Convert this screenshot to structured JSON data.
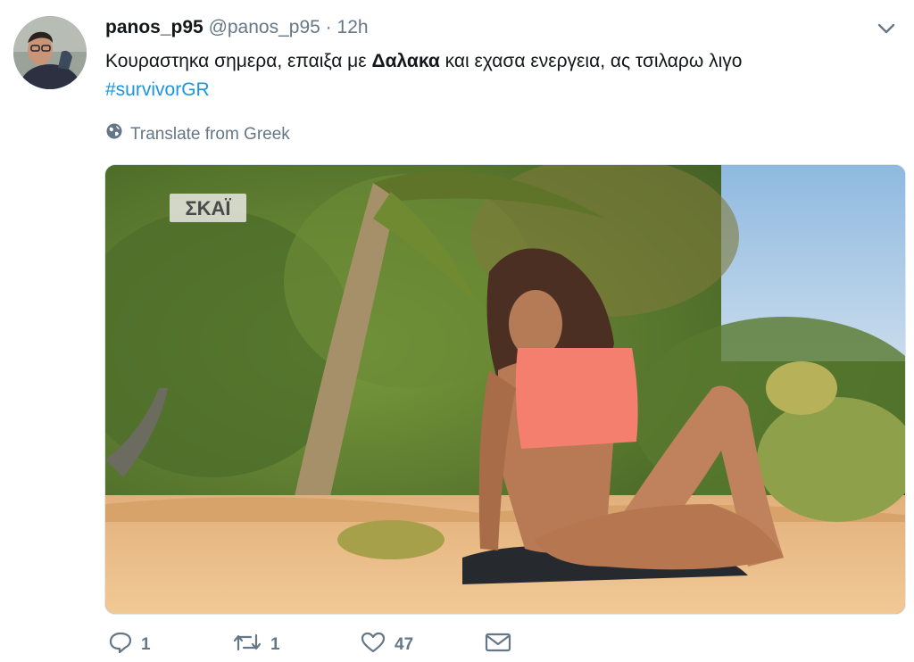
{
  "tweet": {
    "display_name": "panos_p95",
    "handle": "@panos_p95",
    "separator": "·",
    "time": "12h",
    "text_before": "Κουραστηκα σημερα, επαιξα με ",
    "text_bold": "Δαλακα",
    "text_after": " και εχασα ενεργεια, ας τσιλαρω λιγο",
    "hashtag": "#survivorGR",
    "translate_label": "Translate from Greek"
  },
  "media": {
    "channel_logo": "ΣΚΑΪ",
    "description": "woman sitting on a sandy beach in a coral bikini top under palm trees"
  },
  "actions": {
    "reply_count": "1",
    "retweet_count": "1",
    "like_count": "47",
    "icons": [
      "reply-icon",
      "retweet-icon",
      "like-icon",
      "message-icon"
    ]
  },
  "colors": {
    "link": "#1b95e0",
    "secondary": "#657786"
  }
}
